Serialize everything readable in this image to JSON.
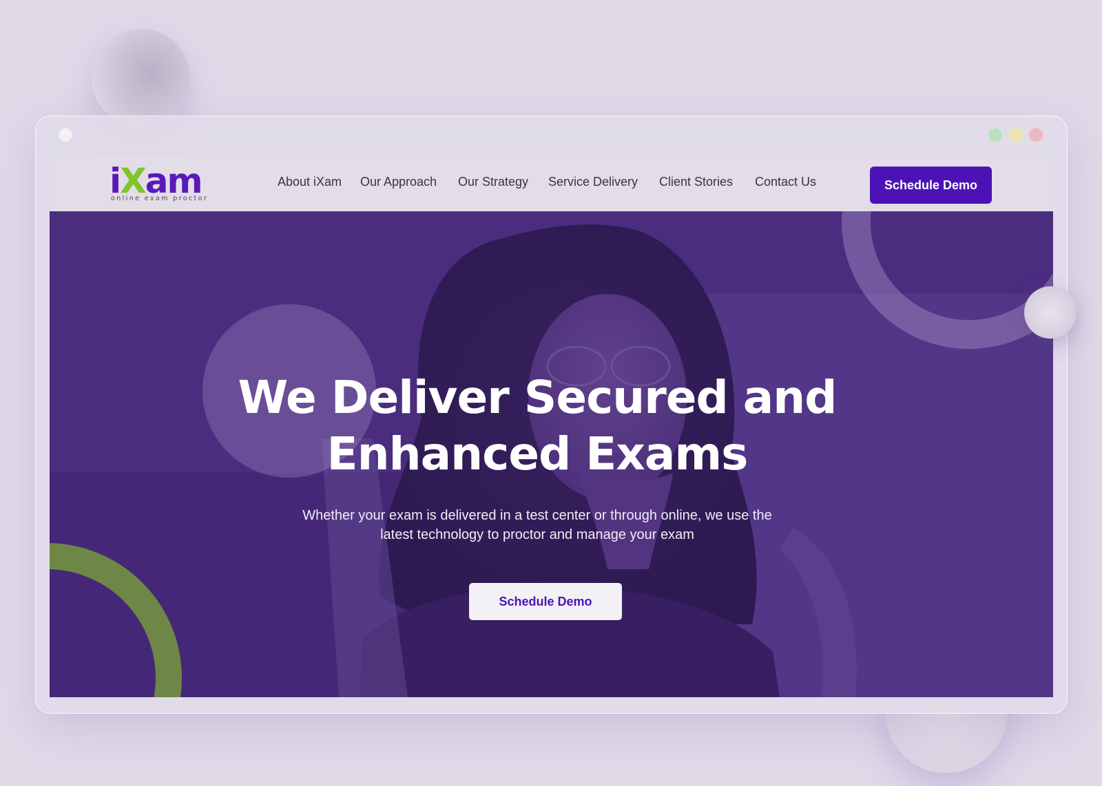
{
  "brand": {
    "logo_prefix": "i",
    "logo_x": "X",
    "logo_suffix": "am",
    "tagline": "online exam proctor"
  },
  "nav": {
    "links": [
      "About iXam",
      "Our Approach",
      "Our Strategy",
      "Service Delivery",
      "Client Stories",
      "Contact Us"
    ],
    "cta_label": "Schedule Demo"
  },
  "hero": {
    "title_line1": "We Deliver Secured and",
    "title_line2": "Enhanced Exams",
    "subtitle_line1": "Whether your exam is delivered in a test center or through online, we use the",
    "subtitle_line2": "latest technology to proctor and manage your exam",
    "cta_label": "Schedule Demo"
  },
  "colors": {
    "brand_purple": "#4b13b5",
    "brand_green": "#7fc52c",
    "hero_overlay": "#4d2c8a",
    "ring_green": "#6e8746",
    "page_bg": "#e0d9e8"
  },
  "icons": {
    "hero_image": "woman-smiling-at-laptop-photo"
  }
}
